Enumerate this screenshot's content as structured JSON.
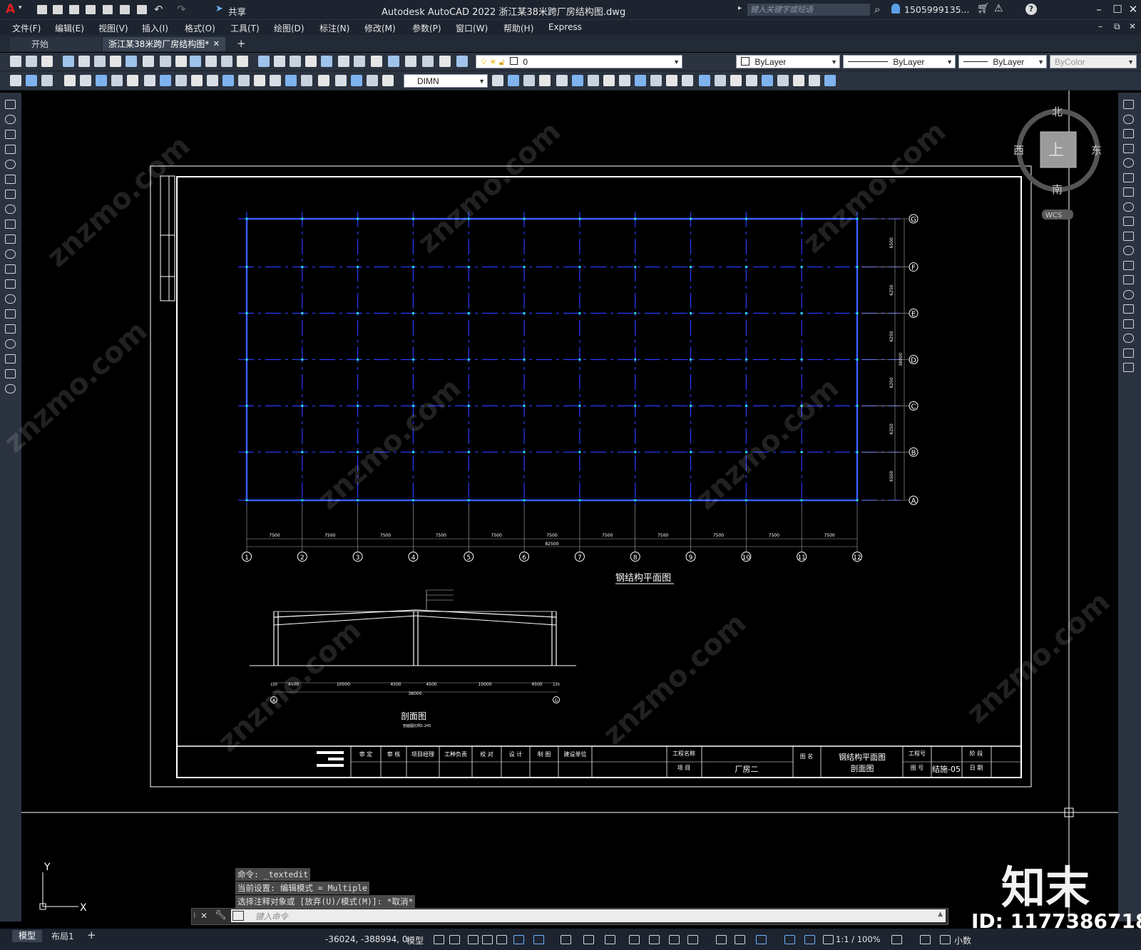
{
  "app": {
    "logo_letter": "A",
    "share_label": "共享",
    "title": "Autodesk AutoCAD 2022    浙江某38米跨厂房结构图.dwg",
    "search_placeholder": "键入关键字或短语",
    "user": "1505999135...",
    "help": "?"
  },
  "menu": [
    "文件(F)",
    "编辑(E)",
    "视图(V)",
    "插入(I)",
    "格式(O)",
    "工具(T)",
    "绘图(D)",
    "标注(N)",
    "修改(M)",
    "参数(P)",
    "窗口(W)",
    "帮助(H)",
    "Express"
  ],
  "tabs": {
    "start": "开始",
    "drawing": "浙江某38米跨厂房结构图*",
    "close": "✕",
    "add": "+"
  },
  "toolbar": {
    "layer_value": "0",
    "color": "ByLayer",
    "linetype": "ByLayer",
    "lineweight": "ByLayer",
    "plotstyle": "ByColor",
    "dimstyle": "DIMN"
  },
  "viewcube": {
    "north": "北",
    "south": "南",
    "east": "东",
    "west": "西",
    "top": "上",
    "wcs": "WCS"
  },
  "drawing": {
    "plan_title": "钢结构平面图",
    "section_title": "剖面图",
    "section_subtitle": "剖面图比例1:245",
    "row_labels": [
      "G",
      "F",
      "E",
      "D",
      "C",
      "B",
      "A"
    ],
    "row_dims": [
      "6500",
      "6250",
      "6250",
      "6250",
      "6250",
      "6500"
    ],
    "row_total": "38000",
    "col_labels": [
      "1",
      "2",
      "3",
      "4",
      "5",
      "6",
      "7",
      "8",
      "9",
      "10",
      "11",
      "12"
    ],
    "col_dims": [
      "7500",
      "7500",
      "7500",
      "7500",
      "7500",
      "7500",
      "7500",
      "7500",
      "7500",
      "7500",
      "7500"
    ],
    "col_total": "82500",
    "section_dims": [
      "4500",
      "10000",
      "4500",
      "4500",
      "10000",
      "4500"
    ],
    "section_total": "38000",
    "section_end_dims": [
      "120",
      "120"
    ],
    "section_axes": [
      "A",
      "G"
    ],
    "title_block": {
      "cells": [
        "审 定",
        "审 核",
        "项目经理",
        "工种负责",
        "校 对",
        "设 计",
        "制 图",
        "建设单位"
      ],
      "project_name_label": "工程名称",
      "item_label": "项 目",
      "item_value": "厂房二",
      "drawing_name_label": "图 名",
      "drawing_name_value_1": "钢结构平面图",
      "drawing_name_value_2": "剖面图",
      "project_no_label": "工程号",
      "drawing_no_label": "图 号",
      "drawing_no_value": "结施-05",
      "stage_label": "阶 段",
      "date_label": "日 期"
    }
  },
  "command": {
    "history": [
      "命令: _textedit",
      "当前设置: 编辑模式 = Multiple",
      "选择注释对象或 [放弃(U)/模式(M)]: *取消*"
    ],
    "placeholder": "键入命令"
  },
  "ucs": {
    "x": "X",
    "y": "Y"
  },
  "status": {
    "tab_model": "模型",
    "tab_layout": "布局1",
    "coords": "-36024, -388994, 0",
    "space": "模型",
    "scale": "1:1 / 100%",
    "units": "小数"
  },
  "watermark": {
    "brand": "知末",
    "id": "ID: 1177386718",
    "url": "znzmo.com"
  }
}
